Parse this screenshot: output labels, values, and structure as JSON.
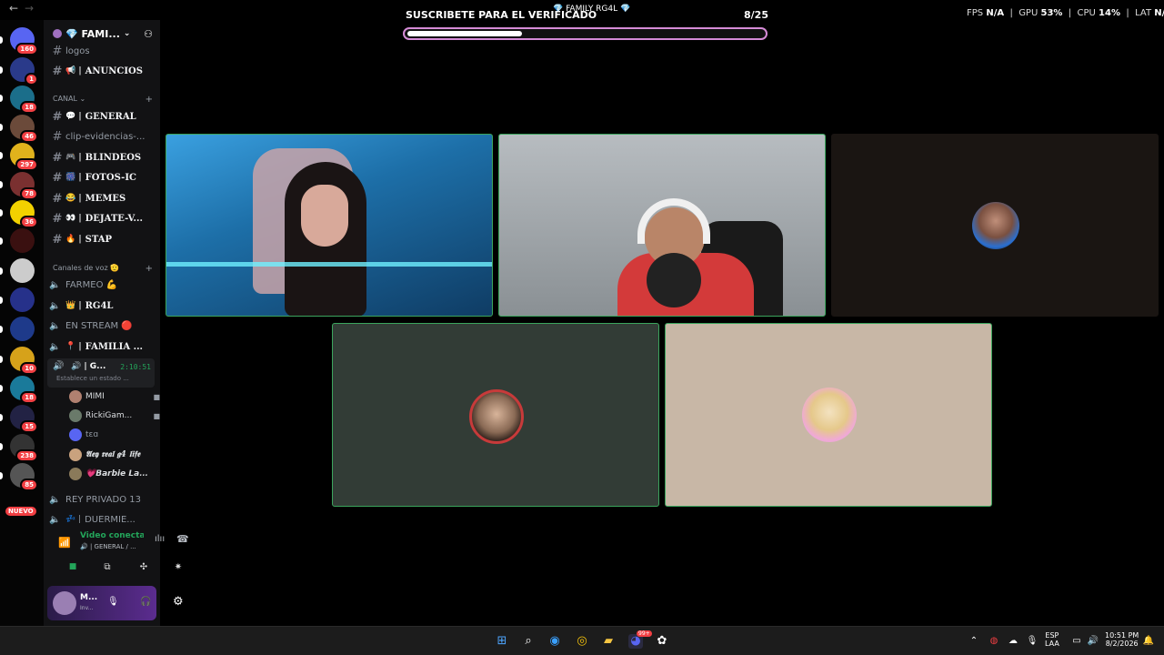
{
  "topbar": {
    "back_arrow": "←",
    "forward_arrow": "→",
    "banner_text": "SUSCRIBETE PARA EL VERIFICADO",
    "window_title": "💎 FAMILY RG4L 💎",
    "progress_count": "8/25",
    "progress_fraction": 0.32,
    "fps_label": "FPS",
    "fps_value": "N/A",
    "gpu_label": "GPU",
    "gpu_value": "53%",
    "cpu_label": "CPU",
    "cpu_value": "14%",
    "lat_label": "LAT",
    "lat_value": "N/A"
  },
  "guild_rail": {
    "items": [
      {
        "icon": "discord-logo-icon",
        "badge": "160",
        "color": "#5865f2"
      },
      {
        "icon": "micro-server-icon",
        "badge": "1",
        "color": "#2a3a8a"
      },
      {
        "icon": "server-icon",
        "badge": "18",
        "color": "#1b6e8a"
      },
      {
        "icon": "server-icon",
        "badge": "46",
        "color": "#6b4a3a"
      },
      {
        "icon": "server-icon",
        "badge": "297",
        "color": "#e0b21c"
      },
      {
        "icon": "server-icon",
        "badge": "78",
        "color": "#7a3030"
      },
      {
        "icon": "server-icon",
        "badge": "36",
        "color": "#f2d100"
      },
      {
        "icon": "rg4l-server-icon",
        "badge": "",
        "color": "#3a1010"
      },
      {
        "icon": "server-icon",
        "badge": "",
        "color": "#cccccc"
      },
      {
        "icon": "server-icon",
        "badge": "",
        "color": "#26318a"
      },
      {
        "icon": "server-icon",
        "badge": "",
        "color": "#1e3a8a"
      },
      {
        "icon": "server-icon",
        "badge": "10",
        "color": "#d6a21a"
      },
      {
        "icon": "server-icon",
        "badge": "18",
        "color": "#1a7a9a"
      },
      {
        "icon": "server-icon",
        "badge": "15",
        "color": "#222244"
      },
      {
        "icon": "server-icon",
        "badge": "238",
        "color": "#333333"
      },
      {
        "icon": "server-icon",
        "badge": "85",
        "color": "#555555"
      }
    ],
    "new_label": "NUEVO"
  },
  "sidebar": {
    "server_name": "💎 FAMI...",
    "channels_top": [
      {
        "name": "logos",
        "emoji": "",
        "bold": false
      },
      {
        "name": "ANUNCIOS",
        "emoji": "📢 |",
        "bold": true
      }
    ],
    "category_canal": "CANAL",
    "text_channels": [
      {
        "name": "GENERAL",
        "emoji": "💬 |",
        "bold": true
      },
      {
        "name": "clip-evidencias-...",
        "emoji": "",
        "bold": false
      },
      {
        "name": "BLINDEOS",
        "emoji": "🎮 |",
        "bold": true
      },
      {
        "name": "FOTOS-IC",
        "emoji": "🎆 |",
        "bold": true
      },
      {
        "name": "MEMES",
        "emoji": "😂 |",
        "bold": true
      },
      {
        "name": "DEJATE-V...",
        "emoji": "👀 |",
        "bold": true
      },
      {
        "name": "STAP",
        "emoji": "🔥 |",
        "bold": true
      }
    ],
    "category_voice": "Canales de voz 🫡",
    "voice_channels": [
      {
        "name": "FARMEO 💪",
        "emoji": "",
        "bold": false
      },
      {
        "name": "RG4L",
        "emoji": "👑 |",
        "bold": true
      },
      {
        "name": "EN STREAM 🔴",
        "emoji": "",
        "bold": false
      },
      {
        "name": "FAMILIA ...",
        "emoji": "📍 |",
        "bold": true
      }
    ],
    "active_voice": {
      "name": "G...",
      "emoji": "🔊 |",
      "timer": "2:10:51",
      "status_placeholder": "Establece un estado ..."
    },
    "members": [
      {
        "name": "MIMI",
        "camera": true,
        "avatar_color": "#b08070"
      },
      {
        "name": "RickiGam...",
        "camera": true,
        "avatar_color": "#6a7a6a"
      },
      {
        "name": "tɛɑ",
        "camera": false,
        "avatar_color": "#5865f2"
      },
      {
        "name": "𝕬𝖊𝖞 𝖗𝖊𝖆𝖑 𝖌4 𝖑𝖎𝖋𝖊",
        "camera": false,
        "avatar_color": "#c9a27e"
      },
      {
        "name": "💗𝘽𝙖𝙧𝙗𝙞𝙚 𝙇𝙖...",
        "camera": false,
        "avatar_color": "#8a7a5a"
      }
    ],
    "voice_channels_bottom": [
      {
        "name": "REY PRIVADO 13",
        "emoji": "",
        "bold": false
      },
      {
        "name": "DUERMIE...",
        "emoji": "💤 |",
        "bold": false
      }
    ],
    "voice_connected": {
      "status": "Video conectad",
      "channel": "🔊 | GENERAL / ..."
    },
    "user": {
      "name": "M...",
      "status": "Inv..."
    }
  },
  "video": {
    "tiles": [
      {
        "label": "participant-1-video",
        "kind": "camera",
        "bg": "#2e7fb6"
      },
      {
        "label": "participant-2-video",
        "kind": "camera",
        "bg": "#9ea4a8"
      },
      {
        "label": "participant-3-avatar",
        "kind": "avatar",
        "bg": "#1a1512"
      },
      {
        "label": "participant-4-avatar",
        "kind": "avatar",
        "bg": "#323c36"
      },
      {
        "label": "participant-5-avatar",
        "kind": "avatar",
        "bg": "#c8b7a6"
      }
    ]
  },
  "taskbar": {
    "lang": "ESP",
    "lang2": "LAA",
    "time": "10:51 PM",
    "date": "8/2/2026",
    "discord_badge": "99+"
  },
  "colors": {
    "accent_green": "#3ba55d",
    "badge_red": "#f23f43",
    "progress_border": "#d58bd6"
  }
}
